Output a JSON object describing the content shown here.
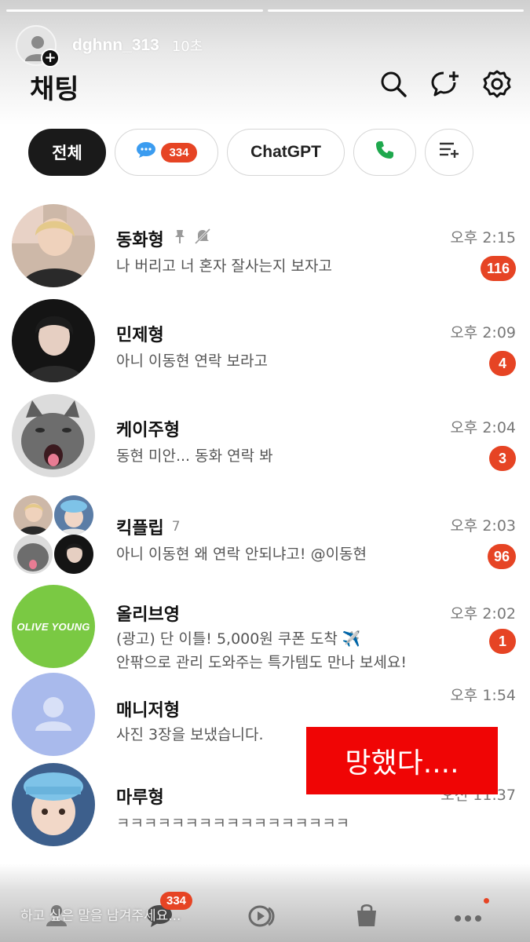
{
  "story": {
    "username": "dghnn_313",
    "time_ago": "10초",
    "reply_placeholder": "하고 싶은 말을 남겨주세요..."
  },
  "header": {
    "title": "채팅",
    "icons": [
      "search-icon",
      "new-chat-icon",
      "settings-icon"
    ]
  },
  "filters": {
    "all_label": "전체",
    "unread_badge": "334",
    "chatgpt_label": "ChatGPT",
    "icons": [
      "chat-bubble-icon",
      "phone-icon",
      "edit-list-icon"
    ]
  },
  "chats": [
    {
      "name": "동화형",
      "preview": "나 버리고 너 혼자 잘사는지 보자고",
      "time": "오후 2:15",
      "badge": "116",
      "pinned": true,
      "muted": true
    },
    {
      "name": "민제형",
      "preview": "아니 이동현 연락 보라고",
      "time": "오후 2:09",
      "badge": "4"
    },
    {
      "name": "케이주형",
      "preview": "동현 미안... 동화 연락 봐",
      "time": "오후 2:04",
      "badge": "3"
    },
    {
      "name": "킥플립",
      "member_count": "7",
      "preview": "아니 이동현 왜 연락 안되냐고! @이동현",
      "time": "오후 2:03",
      "badge": "96"
    },
    {
      "name": "올리브영",
      "avatar_text": "OLIVE YOUNG",
      "preview": "(광고) 단 이틀! 5,000원 쿠폰 도착 ✈️",
      "preview_line2": "안팎으로 관리 도와주는 특가템도 만나 보세요!",
      "time": "오후 2:02",
      "badge": "1"
    },
    {
      "name": "매니저형",
      "preview": "사진 3장을 보냈습니다.",
      "time": "오후 1:54"
    },
    {
      "name": "마루형",
      "preview": "ㅋㅋㅋㅋㅋㅋㅋㅋㅋㅋㅋㅋㅋㅋㅋㅋㅋ",
      "time": "오전 11:37"
    }
  ],
  "overlay": {
    "sticker_text": "망했다...."
  },
  "tabbar": {
    "chat_badge": "334",
    "icons": [
      "friends-icon",
      "chats-icon",
      "openchat-icon",
      "shopping-icon",
      "more-icon"
    ]
  },
  "colors": {
    "badge": "#e64424",
    "sticker": "#f00505",
    "olive_young": "#7ac943"
  }
}
